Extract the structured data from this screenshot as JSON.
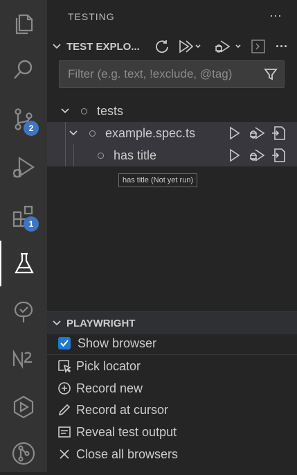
{
  "activity_bar": {
    "items": [
      {
        "name": "explorer",
        "icon": "files-icon"
      },
      {
        "name": "search",
        "icon": "search-icon"
      },
      {
        "name": "source-control",
        "icon": "source-control-icon",
        "badge": "2"
      },
      {
        "name": "run-debug",
        "icon": "run-debug-icon"
      },
      {
        "name": "extensions",
        "icon": "extensions-icon",
        "badge": "1"
      },
      {
        "name": "testing",
        "icon": "beaker-icon",
        "active": true
      },
      {
        "name": "tree",
        "icon": "tree-icon"
      },
      {
        "name": "nx",
        "icon": "nx-icon"
      },
      {
        "name": "play",
        "icon": "play-hex-icon"
      },
      {
        "name": "git-graph",
        "icon": "git-graph-icon"
      }
    ]
  },
  "sidebar": {
    "title": "TESTING",
    "more": "···"
  },
  "test_explorer": {
    "header": "TEST EXPLO...",
    "filter_placeholder": "Filter (e.g. text, !exclude, @tag)",
    "tree": {
      "root": "tests",
      "file": "example.spec.ts",
      "test": "has title"
    },
    "tooltip": "has title (Not yet run)"
  },
  "playwright": {
    "header": "PLAYWRIGHT",
    "show_browser": "Show browser",
    "show_browser_checked": true,
    "actions": [
      {
        "label": "Pick locator",
        "icon": "pick-locator-icon"
      },
      {
        "label": "Record new",
        "icon": "record-new-icon"
      },
      {
        "label": "Record at cursor",
        "icon": "pencil-icon"
      },
      {
        "label": "Reveal test output",
        "icon": "output-icon"
      },
      {
        "label": "Close all browsers",
        "icon": "close-icon"
      }
    ]
  },
  "colors": {
    "accent_badge": "#3d76c2",
    "checkbox": "#1d78d6",
    "selected_row": "#37373d",
    "sidebar_bg": "#252526",
    "activity_bg": "#333333"
  }
}
